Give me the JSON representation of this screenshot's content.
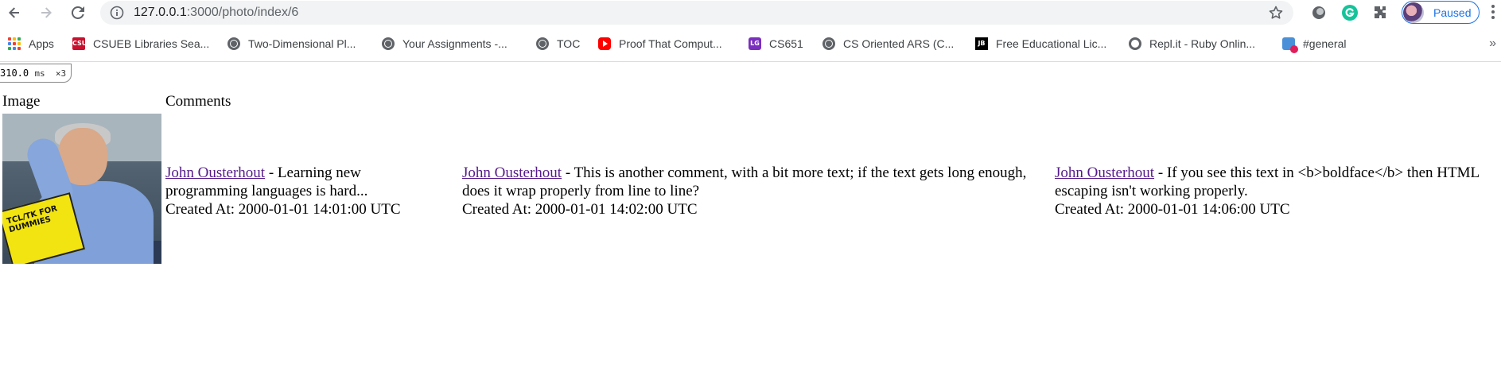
{
  "browser": {
    "url_host": "127.0.0.1",
    "url_path": ":3000/photo/index/6",
    "profile_label": "Paused"
  },
  "bookmarks": [
    {
      "label": "Apps",
      "icon": "apps-grid-icon"
    },
    {
      "label": "CSUEB Libraries Sea...",
      "icon": "csu-logo-icon"
    },
    {
      "label": "Two-Dimensional Pl...",
      "icon": "globe-icon"
    },
    {
      "label": "Your Assignments -...",
      "icon": "globe-icon"
    },
    {
      "label": "TOC",
      "icon": "globe-icon"
    },
    {
      "label": "Proof That Comput...",
      "icon": "youtube-icon"
    },
    {
      "label": "CS651",
      "icon": "lg-logo-icon"
    },
    {
      "label": "CS Oriented ARS (C...",
      "icon": "globe-icon"
    },
    {
      "label": "Free Educational Lic...",
      "icon": "jetbrains-icon"
    },
    {
      "label": "Repl.it - Ruby Onlin...",
      "icon": "replit-icon"
    },
    {
      "label": "#general",
      "icon": "chat-badge-icon"
    }
  ],
  "timing": {
    "value": "310.0",
    "unit": "ms",
    "count": "×3"
  },
  "page": {
    "header_image": "Image",
    "header_comments": "Comments",
    "photo_book_text": "TCL/TK FOR DUMMIES",
    "comments": [
      {
        "author": "John Ousterhout",
        "separator": " - ",
        "text": "Learning new programming languages is hard...",
        "created": "Created At: 2000-01-01 14:01:00 UTC"
      },
      {
        "author": "John Ousterhout",
        "separator": " - ",
        "text": "This is another comment, with a bit more text; if the text gets long enough, does it wrap properly from line to line?",
        "created": "Created At: 2000-01-01 14:02:00 UTC"
      },
      {
        "author": "John Ousterhout",
        "separator": " - ",
        "text": "If you see this text in <b>boldface</b> then HTML escaping isn't working properly.",
        "created": "Created At: 2000-01-01 14:06:00 UTC"
      }
    ]
  }
}
